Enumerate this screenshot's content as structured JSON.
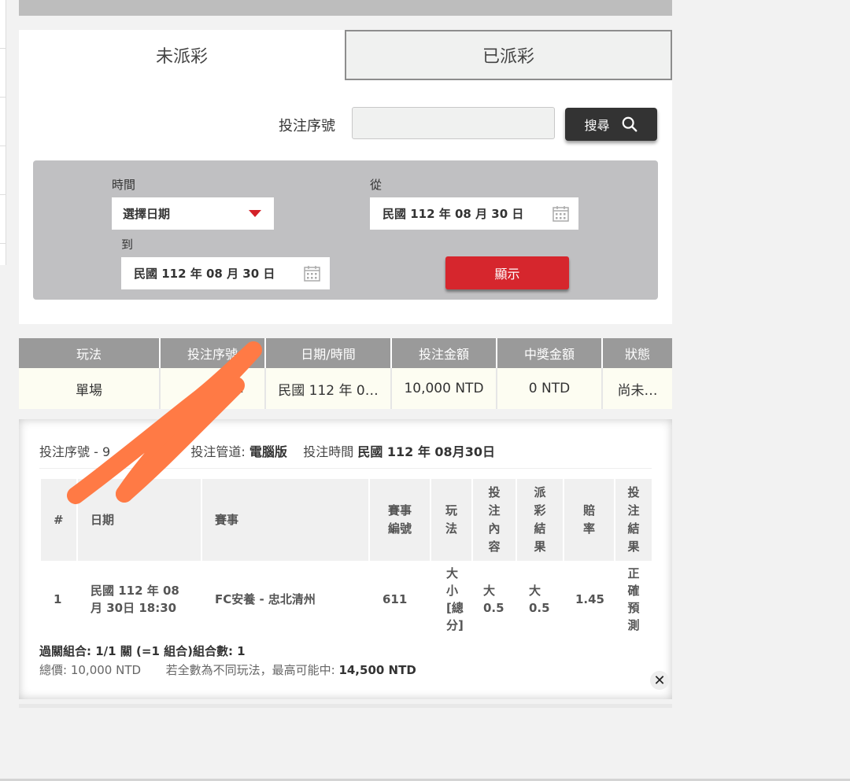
{
  "tabs": {
    "unsettled": "未派彩",
    "settled": "已派彩"
  },
  "search": {
    "serial_label": "投注序號",
    "serial_value": "",
    "button_label": "搜尋"
  },
  "filter": {
    "time_label": "時間",
    "date_select_value": "選擇日期",
    "from_label": "從",
    "from_value": "民國 112 年 08 月 30 日",
    "to_label": "到",
    "to_value": "民國 112 年 08 月 30 日",
    "show_button": "顯示"
  },
  "results": {
    "headers": [
      "玩法",
      "投注序號",
      "日期/時間",
      "投注金額",
      "中獎金額",
      "狀態"
    ],
    "row": [
      "單場",
      "9…2",
      "民國 112 年 0…",
      "10,000 NTD",
      "0 NTD",
      "尚未…"
    ]
  },
  "detail": {
    "serial_label": "投注序號",
    "serial_value": "- 9",
    "channel_label": "投注管道:",
    "channel_value": "電腦版",
    "time_label": "投注時間",
    "time_value": "民國 112 年 08月30日",
    "headers": [
      "#",
      "日期",
      "賽事",
      "賽事編號",
      "玩法",
      "投注內容",
      "派彩結果",
      "賠率",
      "投注結果"
    ],
    "row": [
      "1",
      "民國 112 年 08月 30日 18:30",
      "FC安養 - 忠北清州",
      "611",
      "大小[總分]",
      "大 0.5",
      "大 0.5",
      "1.45",
      "正確預測"
    ],
    "combo": "過關組合: 1/1 關 (=1 組合)組合數: 1",
    "total_label": "總價:",
    "total_value": "10,000 NTD",
    "max_win_label": "若全數為不同玩法，最高可能中:",
    "max_win_value": "14,500 NTD",
    "close_symbol": "✕"
  },
  "icons": {
    "search": "search-icon",
    "calendar": "calendar-icon",
    "dropdown": "caret-down-icon",
    "close": "close-icon"
  },
  "colors": {
    "accent_red": "#d6262d",
    "dark_button": "#333333",
    "header_gray": "#9a9a9a",
    "scribble_orange": "#ff7a45"
  }
}
